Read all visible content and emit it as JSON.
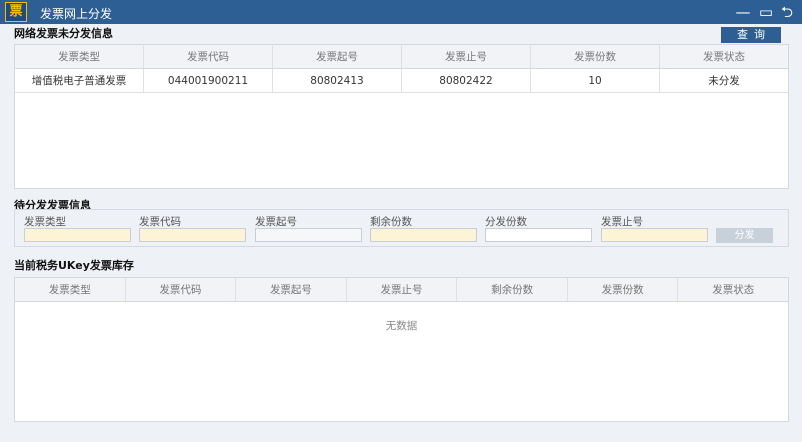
{
  "titlebar": {
    "logo_char": "票",
    "title": "发票网上分发",
    "minimize_glyph": "—",
    "maximize_glyph": "▭",
    "close_glyph": "⮌"
  },
  "network_section": {
    "title": "网络发票未分发信息",
    "query_label": "查询",
    "columns": [
      "发票类型",
      "发票代码",
      "发票起号",
      "发票止号",
      "发票份数",
      "发票状态"
    ],
    "rows": [
      [
        "增值税电子普通发票",
        "044001900211",
        "80802413",
        "80802422",
        "10",
        "未分发"
      ]
    ]
  },
  "pending_section": {
    "title": "待分发发票信息",
    "fields": [
      {
        "label": "发票类型",
        "value": ""
      },
      {
        "label": "发票代码",
        "value": ""
      },
      {
        "label": "发票起号",
        "value": ""
      },
      {
        "label": "剩余份数",
        "value": ""
      },
      {
        "label": "分发份数",
        "value": ""
      },
      {
        "label": "发票止号",
        "value": ""
      }
    ],
    "distribute_label": "分发"
  },
  "stock_section": {
    "title": "当前税务UKey发票库存",
    "columns": [
      "发票类型",
      "发票代码",
      "发票起号",
      "发票止号",
      "剩余份数",
      "发票份数",
      "发票状态"
    ],
    "empty_text": "无数据"
  },
  "colors": {
    "titlebar": "#2d5f95",
    "accent_button": "#2d5f95",
    "highlight_field": "#fdf3d7"
  }
}
